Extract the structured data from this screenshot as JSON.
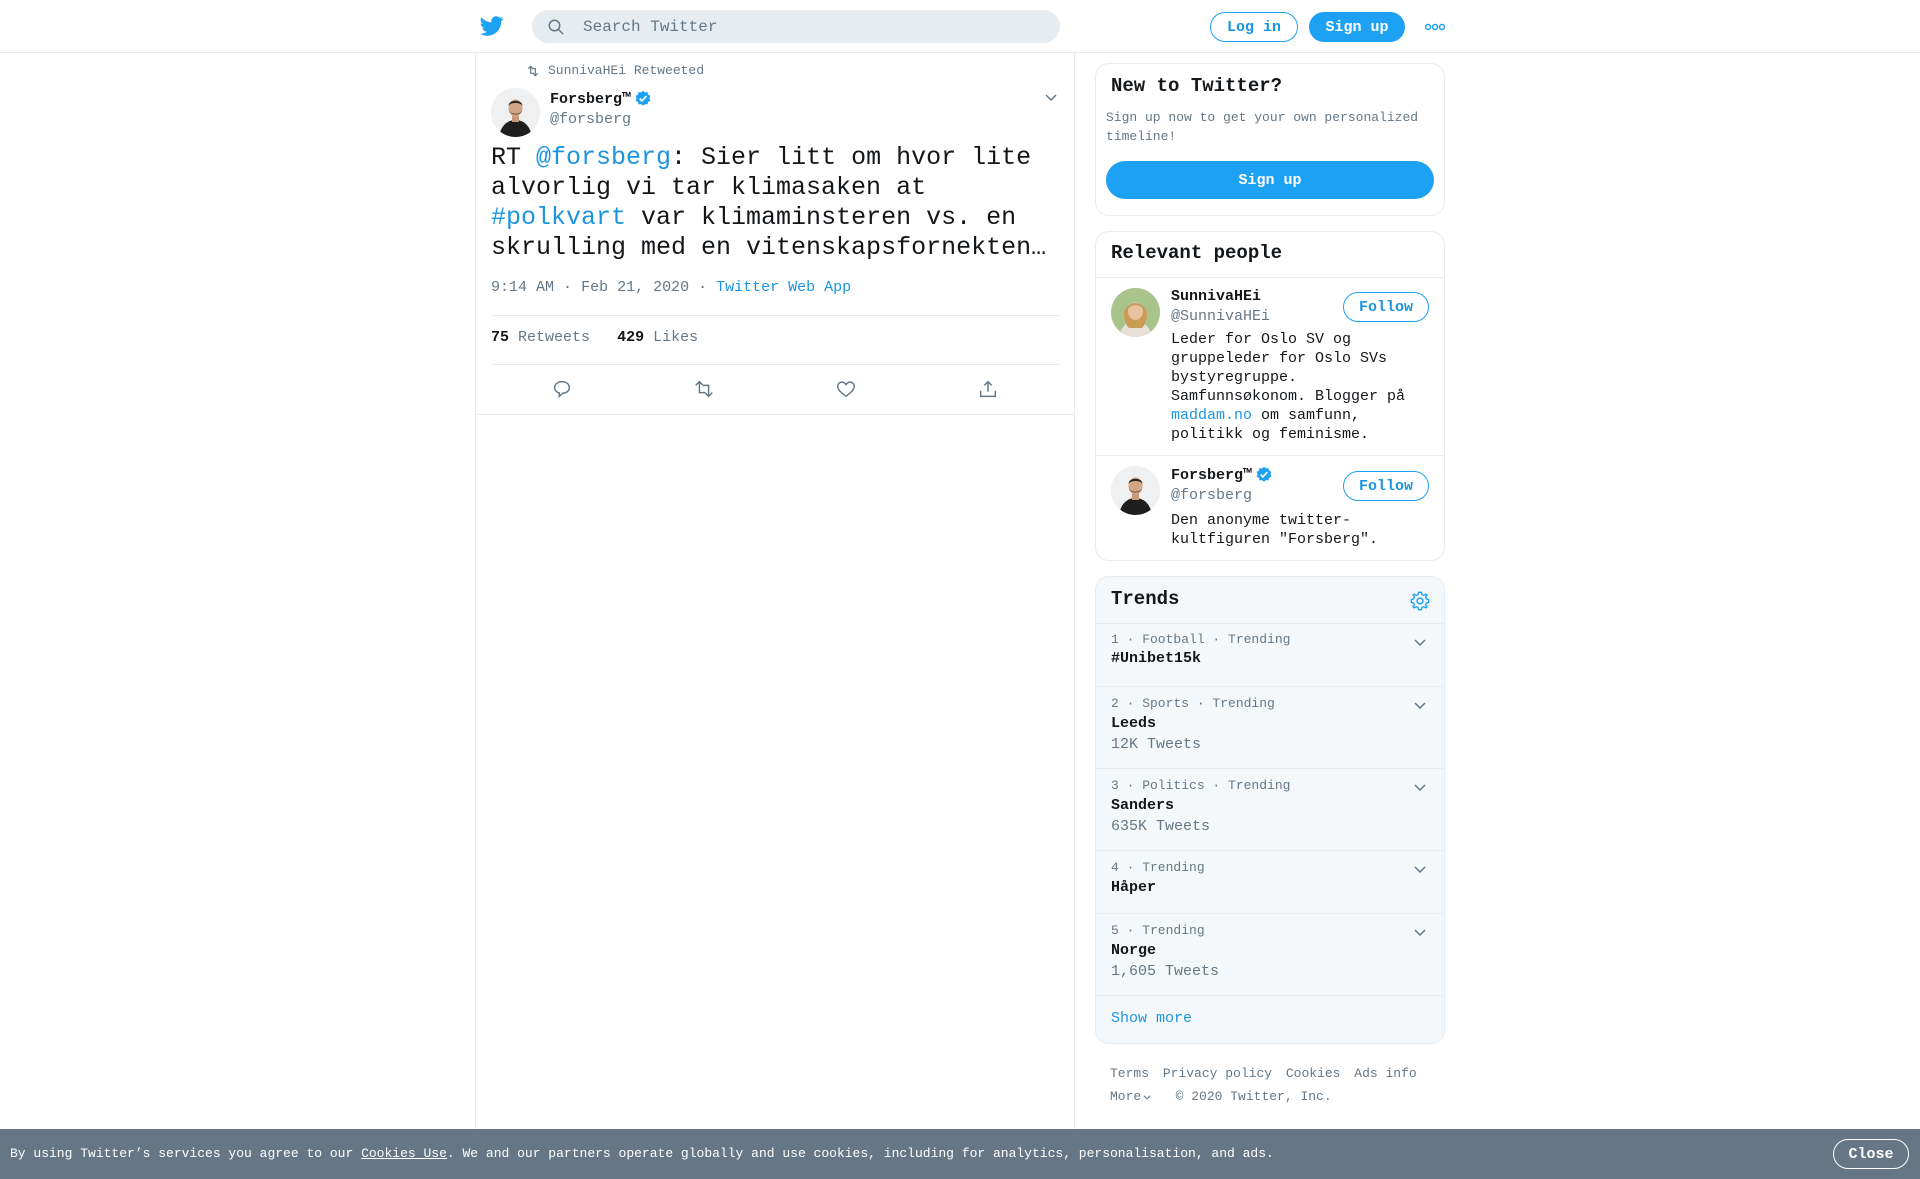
{
  "topbar": {
    "logo_icon": "twitter-bird-icon",
    "search_placeholder": "Search Twitter",
    "login_label": "Log in",
    "signup_label": "Sign up",
    "more_icon": "more-dots-icon"
  },
  "tweet": {
    "retweeted_by": "SunnivaHEi Retweeted",
    "author_name": "Forsberg™",
    "author_handle": "@forsberg",
    "text_prefix": "RT ",
    "mention": "@forsberg",
    "text_mid": ": Sier litt om hvor lite alvorlig vi tar klimasaken at ",
    "hashtag": "#polkvart",
    "text_suffix": " var klimaminsteren vs. en skrulling med en vitenskapsfornekten…",
    "time": "9:14 AM",
    "separator": "·",
    "date": "Feb 21, 2020",
    "source": "Twitter Web App",
    "retweets_count": "75",
    "retweets_label": "Retweets",
    "likes_count": "429",
    "likes_label": "Likes"
  },
  "signup_card": {
    "title": "New to Twitter?",
    "subtitle": "Sign up now to get your own personalized timeline!",
    "button": "Sign up"
  },
  "relevant": {
    "title": "Relevant people",
    "people": [
      {
        "name": "SunnivaHEi",
        "handle": "@SunnivaHEi",
        "follow": "Follow",
        "bio_pre": "Leder for Oslo SV og gruppeleder for Oslo SVs bystyregruppe. Samfunnsøkonom. Blogger på ",
        "bio_link": "maddam.no",
        "bio_post": " om samfunn, politikk og feminisme."
      },
      {
        "name": "Forsberg™",
        "handle": "@forsberg",
        "follow": "Follow",
        "bio": "Den anonyme twitter-kultfiguren \"Forsberg\"."
      }
    ]
  },
  "trends": {
    "title": "Trends",
    "items": [
      {
        "meta": "1 · Football · Trending",
        "name": "#Unibet15k",
        "count": ""
      },
      {
        "meta": "2 · Sports · Trending",
        "name": "Leeds",
        "count": "12K Tweets"
      },
      {
        "meta": "3 · Politics · Trending",
        "name": "Sanders",
        "count": "635K Tweets"
      },
      {
        "meta": "4 · Trending",
        "name": "Håper",
        "count": ""
      },
      {
        "meta": "5 · Trending",
        "name": "Norge",
        "count": "1,605 Tweets"
      }
    ],
    "show_more": "Show more"
  },
  "footer": {
    "terms": "Terms",
    "privacy": "Privacy policy",
    "cookies": "Cookies",
    "ads": "Ads info",
    "more": "More",
    "copyright": "© 2020 Twitter, Inc."
  },
  "cookie_bar": {
    "text_pre": "By using Twitter’s services you agree to our ",
    "link": "Cookies Use",
    "text_post": ". We and our partners operate globally and use cookies, including for analytics, personalisation, and ads.",
    "close": "Close"
  },
  "colors": {
    "accent": "#1da1f2",
    "link": "#1b95e0",
    "muted": "#657786",
    "border": "#e6ecf0",
    "cookie_bar": "#657786"
  }
}
